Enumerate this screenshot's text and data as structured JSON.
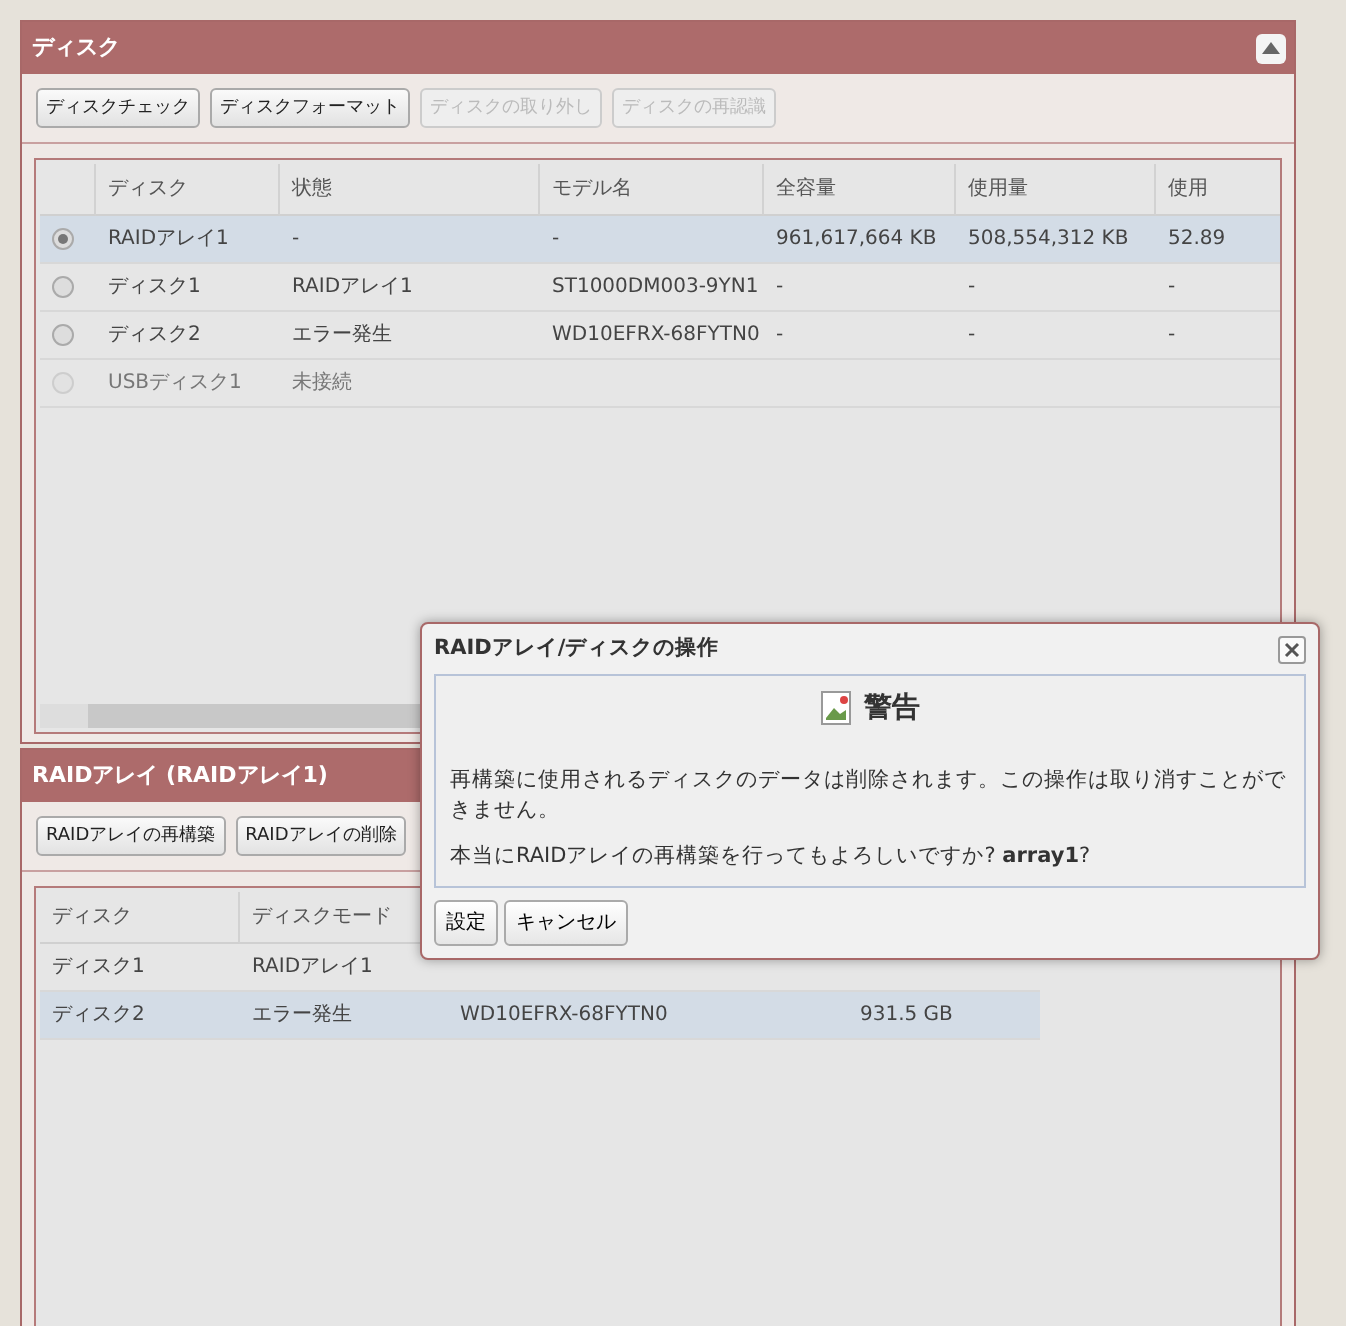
{
  "disk_panel": {
    "title": "ディスク",
    "buttons": [
      {
        "label": "ディスクチェック",
        "disabled": false
      },
      {
        "label": "ディスクフォーマット",
        "disabled": false
      },
      {
        "label": "ディスクの取り外し",
        "disabled": true
      },
      {
        "label": "ディスクの再認識",
        "disabled": true
      }
    ],
    "table": {
      "columns": [
        "ディスク",
        "状態",
        "モデル名",
        "全容量",
        "使用量",
        "使用"
      ],
      "rows": [
        {
          "selected": true,
          "disabled": false,
          "cells": [
            "RAIDアレイ1",
            "-",
            "-",
            "961,617,664 KB",
            "508,554,312 KB",
            "52.89"
          ]
        },
        {
          "selected": false,
          "disabled": false,
          "cells": [
            "ディスク1",
            "RAIDアレイ1",
            "ST1000DM003-9YN1",
            "-",
            "-",
            "-"
          ]
        },
        {
          "selected": false,
          "disabled": false,
          "cells": [
            "ディスク2",
            "エラー発生",
            "WD10EFRX-68FYTN0",
            "-",
            "-",
            "-"
          ]
        },
        {
          "selected": false,
          "disabled": true,
          "cells": [
            "USBディスク1",
            "未接続"
          ]
        }
      ]
    }
  },
  "raid_panel": {
    "title": "RAIDアレイ (RAIDアレイ1)",
    "buttons": [
      {
        "label": "RAIDアレイの再構築",
        "disabled": false
      },
      {
        "label": "RAIDアレイの削除",
        "disabled": false
      }
    ],
    "table": {
      "columns": [
        "ディスク",
        "ディスクモード"
      ],
      "rows": [
        {
          "selected": false,
          "cells": [
            "ディスク1",
            "RAIDアレイ1"
          ]
        },
        {
          "selected": true,
          "cells": [
            "ディスク2",
            "エラー発生",
            "WD10EFRX-68FYTN0",
            "931.5 GB"
          ]
        }
      ]
    }
  },
  "dialog": {
    "title": "RAIDアレイ/ディスクの操作",
    "heading": "警告",
    "message": "再構築に使用されるディスクのデータは削除されます。この操作は取り消すことができません。",
    "question": "本当にRAIDアレイの再構築を行ってもよろしいですか? **array1**?",
    "buttons": [
      "設定",
      "キャンセル"
    ]
  }
}
